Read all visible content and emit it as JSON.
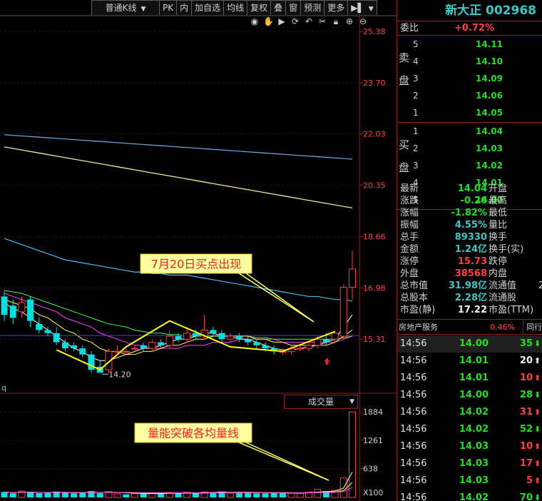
{
  "toolbar": {
    "chart_type": "普通K线",
    "buttons": [
      "PK",
      "内",
      "加自选",
      "均线",
      "复权",
      "叠",
      "窗",
      "预测",
      "更多"
    ]
  },
  "tool_icons": [
    "eye-icon",
    "hand-icon",
    "play-icon",
    "refresh-icon",
    "undo-icon",
    "scissors-icon",
    "lock-icon",
    "zoom-in-icon",
    "zoom-out-icon"
  ],
  "price_axis": [
    "25.38",
    "23.70",
    "22.03",
    "20.35",
    "18.66",
    "16.98",
    "15.31"
  ],
  "volume_axis": [
    "1884",
    "1261",
    "638",
    "X100"
  ],
  "low_label": "14.20",
  "annotations": {
    "buy_point": "7月20日买点出现",
    "volume_break": "量能突破各均量线"
  },
  "volume_selector": "成交量",
  "q_label": "q",
  "stock": {
    "name": "新大正",
    "code": "002968"
  },
  "weibi": {
    "label": "委比",
    "value": "+0.72%"
  },
  "sell_label": [
    "卖",
    "盘"
  ],
  "buy_label": [
    "买",
    "盘"
  ],
  "asks": [
    {
      "level": "5",
      "price": "14.11"
    },
    {
      "level": "4",
      "price": "14.10"
    },
    {
      "level": "3",
      "price": "14.09"
    },
    {
      "level": "2",
      "price": "14.06"
    },
    {
      "level": "1",
      "price": "14.05"
    }
  ],
  "bids": [
    {
      "level": "1",
      "price": "14.04"
    },
    {
      "level": "2",
      "price": "14.03"
    },
    {
      "level": "3",
      "price": "14.02"
    },
    {
      "level": "4",
      "price": "14.01"
    },
    {
      "level": "5",
      "price": "14.00"
    }
  ],
  "stats": [
    {
      "l1": "最新",
      "v1": "14.04",
      "c1": "green",
      "l2": "开盘",
      "v2": ""
    },
    {
      "l1": "涨跌",
      "v1": "-0.26",
      "c1": "green",
      "l2": "最高",
      "v2": ""
    },
    {
      "l1": "涨幅",
      "v1": "-1.82%",
      "c1": "green",
      "l2": "最低",
      "v2": ""
    },
    {
      "l1": "振幅",
      "v1": "4.55%",
      "c1": "cyan",
      "l2": "量比",
      "v2": ""
    },
    {
      "l1": "总手",
      "v1": "89330",
      "c1": "cyan",
      "l2": "换手",
      "v2": ""
    },
    {
      "l1": "金额",
      "v1": "1.24亿",
      "c1": "cyan",
      "l2": "换手(实)",
      "v2": ""
    },
    {
      "l1": "涨停",
      "v1": "15.73",
      "c1": "red",
      "l2": "跌停",
      "v2": ""
    },
    {
      "l1": "外盘",
      "v1": "38568",
      "c1": "red",
      "l2": "内盘",
      "v2": ""
    },
    {
      "l1": "总市值",
      "v1": "31.98亿",
      "c1": "cyan",
      "l2": "流通值",
      "v2": "2"
    },
    {
      "l1": "总股本",
      "v1": "2.28亿",
      "c1": "cyan",
      "l2": "流通股",
      "v2": ""
    },
    {
      "l1": "市盈(静)",
      "v1": "17.22",
      "c1": "white",
      "l2": "市盈(TTM)",
      "v2": ""
    }
  ],
  "sector": {
    "name": "房地产服务",
    "pct": "0.46%",
    "tab": "同行"
  },
  "ticks": [
    {
      "time": "14:56",
      "price": "14.00",
      "vol": "35",
      "dir": "down",
      "vc": "green"
    },
    {
      "time": "14:56",
      "price": "14.01",
      "vol": "20",
      "dir": "up",
      "vc": "white"
    },
    {
      "time": "14:56",
      "price": "14.01",
      "vol": "10",
      "dir": "up",
      "vc": "red"
    },
    {
      "time": "14:56",
      "price": "14.00",
      "vol": "28",
      "dir": "down",
      "vc": "green"
    },
    {
      "time": "14:56",
      "price": "14.02",
      "vol": "31",
      "dir": "up",
      "vc": "red"
    },
    {
      "time": "14:56",
      "price": "14.02",
      "vol": "52",
      "dir": "down",
      "vc": "green"
    },
    {
      "time": "14:56",
      "price": "14.03",
      "vol": "10",
      "dir": "up",
      "vc": "red"
    },
    {
      "time": "14:56",
      "price": "14.03",
      "vol": "17",
      "dir": "up",
      "vc": "red"
    },
    {
      "time": "14:56",
      "price": "14.03",
      "vol": "5",
      "dir": "up",
      "vc": "red"
    },
    {
      "time": "14:56",
      "price": "14.02",
      "vol": "70",
      "dir": "down",
      "vc": "green"
    }
  ],
  "colors": {
    "up": "#ff3c3c",
    "down": "#00e0e0",
    "ma5": "#ffffff",
    "ma10": "#ffff40",
    "ma20": "#ff40ff",
    "ma30": "#40ff40",
    "ma60": "#4fb8e8",
    "ma120": "#f0e6a0",
    "ma250": "#6aa0d0",
    "zigzag": "#ffff00",
    "panel_border": "#8a2020"
  },
  "chart_data": {
    "type": "candlestick",
    "price_ylim": [
      13.6,
      25.9
    ],
    "candles": [
      {
        "o": 16.7,
        "c": 16.1,
        "h": 16.9,
        "l": 15.9
      },
      {
        "o": 16.4,
        "c": 16.0,
        "h": 16.6,
        "l": 15.8
      },
      {
        "o": 16.2,
        "c": 16.5,
        "h": 16.7,
        "l": 16.0
      },
      {
        "o": 16.6,
        "c": 15.9,
        "h": 16.7,
        "l": 15.7
      },
      {
        "o": 15.8,
        "c": 15.6,
        "h": 16.0,
        "l": 15.5
      },
      {
        "o": 15.6,
        "c": 15.5,
        "h": 15.7,
        "l": 15.4
      },
      {
        "o": 15.5,
        "c": 15.2,
        "h": 15.7,
        "l": 15.1
      },
      {
        "o": 15.2,
        "c": 15.0,
        "h": 15.3,
        "l": 14.9
      },
      {
        "o": 15.1,
        "c": 15.0,
        "h": 15.2,
        "l": 14.9
      },
      {
        "o": 15.0,
        "c": 14.8,
        "h": 15.1,
        "l": 14.7
      },
      {
        "o": 14.8,
        "c": 14.3,
        "h": 14.9,
        "l": 14.2
      },
      {
        "o": 14.4,
        "c": 14.2,
        "h": 14.6,
        "l": 14.2
      },
      {
        "o": 14.3,
        "c": 14.9,
        "h": 15.0,
        "l": 14.2
      },
      {
        "o": 14.9,
        "c": 14.9,
        "h": 15.1,
        "l": 14.8
      },
      {
        "o": 14.9,
        "c": 14.9,
        "h": 15.0,
        "l": 14.8
      },
      {
        "o": 15.0,
        "c": 15.0,
        "h": 15.1,
        "l": 14.9
      },
      {
        "o": 15.1,
        "c": 15.0,
        "h": 15.2,
        "l": 14.9
      },
      {
        "o": 15.0,
        "c": 15.2,
        "h": 15.3,
        "l": 14.9
      },
      {
        "o": 15.2,
        "c": 15.1,
        "h": 15.3,
        "l": 15.0
      },
      {
        "o": 15.1,
        "c": 15.4,
        "h": 15.6,
        "l": 15.0
      },
      {
        "o": 15.4,
        "c": 15.3,
        "h": 15.5,
        "l": 15.2
      },
      {
        "o": 15.3,
        "c": 15.5,
        "h": 15.7,
        "l": 15.2
      },
      {
        "o": 15.5,
        "c": 15.4,
        "h": 15.6,
        "l": 15.3
      },
      {
        "o": 15.4,
        "c": 15.6,
        "h": 16.1,
        "l": 15.3
      },
      {
        "o": 15.6,
        "c": 15.5,
        "h": 15.7,
        "l": 15.4
      },
      {
        "o": 15.5,
        "c": 15.3,
        "h": 15.6,
        "l": 15.2
      },
      {
        "o": 15.3,
        "c": 15.4,
        "h": 15.5,
        "l": 15.2
      },
      {
        "o": 15.4,
        "c": 15.3,
        "h": 15.5,
        "l": 15.2
      },
      {
        "o": 15.3,
        "c": 15.2,
        "h": 15.4,
        "l": 15.1
      },
      {
        "o": 15.2,
        "c": 15.1,
        "h": 15.3,
        "l": 15.0
      },
      {
        "o": 15.1,
        "c": 15.0,
        "h": 15.2,
        "l": 14.9
      },
      {
        "o": 15.0,
        "c": 14.9,
        "h": 15.1,
        "l": 14.8
      },
      {
        "o": 14.9,
        "c": 14.9,
        "h": 15.0,
        "l": 14.8
      },
      {
        "o": 14.9,
        "c": 15.0,
        "h": 15.1,
        "l": 14.8
      },
      {
        "o": 15.0,
        "c": 15.0,
        "h": 15.1,
        "l": 14.9
      },
      {
        "o": 15.0,
        "c": 15.1,
        "h": 15.2,
        "l": 14.9
      },
      {
        "o": 15.1,
        "c": 15.3,
        "h": 15.4,
        "l": 15.0
      },
      {
        "o": 15.3,
        "c": 15.2,
        "h": 15.5,
        "l": 15.1
      },
      {
        "o": 15.3,
        "c": 15.5,
        "h": 15.6,
        "l": 15.2
      },
      {
        "o": 15.4,
        "c": 17.0,
        "h": 17.1,
        "l": 15.3
      },
      {
        "o": 17.0,
        "c": 17.6,
        "h": 18.2,
        "l": 16.6
      }
    ],
    "volume_ylim": [
      0,
      1950
    ],
    "volumes": [
      120,
      90,
      140,
      110,
      95,
      100,
      130,
      105,
      90,
      115,
      140,
      95,
      130,
      80,
      70,
      90,
      85,
      100,
      80,
      110,
      95,
      115,
      100,
      120,
      110,
      130,
      95,
      105,
      120,
      90,
      85,
      110,
      95,
      100,
      90,
      120,
      180,
      140,
      160,
      430,
      1884
    ],
    "volume_up": [
      false,
      false,
      true,
      false,
      false,
      false,
      false,
      false,
      false,
      false,
      false,
      false,
      true,
      true,
      false,
      true,
      false,
      true,
      false,
      true,
      false,
      true,
      false,
      true,
      false,
      false,
      true,
      false,
      false,
      false,
      false,
      false,
      false,
      true,
      true,
      true,
      true,
      false,
      true,
      true,
      true
    ],
    "ma": {
      "ma5": [
        16.5,
        16.3,
        16.2,
        16.0,
        15.8,
        15.6,
        15.4,
        15.2,
        15.0,
        14.9,
        14.7,
        14.6,
        14.6,
        14.7,
        14.8,
        14.9,
        15.0,
        15.0,
        15.1,
        15.2,
        15.3,
        15.3,
        15.4,
        15.5,
        15.5,
        15.4,
        15.4,
        15.3,
        15.3,
        15.2,
        15.1,
        15.0,
        14.95,
        14.95,
        15.0,
        15.05,
        15.1,
        15.2,
        15.3,
        15.7,
        16.1
      ],
      "ma10": [
        16.6,
        16.5,
        16.4,
        16.3,
        16.1,
        16.0,
        15.8,
        15.6,
        15.5,
        15.3,
        15.2,
        15.0,
        14.9,
        14.9,
        14.8,
        14.8,
        14.9,
        14.9,
        15.0,
        15.1,
        15.1,
        15.2,
        15.3,
        15.3,
        15.4,
        15.4,
        15.4,
        15.4,
        15.4,
        15.3,
        15.3,
        15.2,
        15.2,
        15.1,
        15.1,
        15.1,
        15.1,
        15.1,
        15.2,
        15.4,
        15.6
      ],
      "ma20": [
        16.8,
        16.7,
        16.6,
        16.5,
        16.4,
        16.3,
        16.2,
        16.0,
        15.9,
        15.8,
        15.7,
        15.5,
        15.4,
        15.3,
        15.2,
        15.1,
        15.1,
        15.0,
        15.0,
        15.0,
        15.0,
        15.1,
        15.1,
        15.1,
        15.2,
        15.2,
        15.2,
        15.3,
        15.3,
        15.3,
        15.3,
        15.3,
        15.2,
        15.2,
        15.2,
        15.2,
        15.2,
        15.2,
        15.2,
        15.3,
        15.4
      ],
      "ma30": [
        16.9,
        16.85,
        16.8,
        16.7,
        16.6,
        16.5,
        16.4,
        16.3,
        16.2,
        16.1,
        16.0,
        15.9,
        15.8,
        15.75,
        15.7,
        15.6,
        15.55,
        15.5,
        15.5,
        15.45,
        15.45,
        15.4,
        15.4,
        15.4,
        15.4,
        15.4,
        15.4,
        15.4,
        15.4,
        15.35,
        15.35,
        15.3,
        15.3,
        15.3,
        15.3,
        15.3,
        15.3,
        15.3,
        15.3,
        15.35,
        15.4
      ],
      "ma60": [
        18.6,
        18.5,
        18.4,
        18.3,
        18.2,
        18.1,
        18.0,
        17.9,
        17.85,
        17.8,
        17.75,
        17.7,
        17.65,
        17.6,
        17.55,
        17.5,
        17.5,
        17.45,
        17.45,
        17.4,
        17.4,
        17.4,
        17.35,
        17.3,
        17.25,
        17.2,
        17.15,
        17.1,
        17.05,
        17.0,
        16.95,
        16.9,
        16.85,
        16.8,
        16.75,
        16.7,
        16.7,
        16.65,
        16.6,
        16.6,
        16.55
      ],
      "ma120": [
        21.6,
        21.55,
        21.5,
        21.45,
        21.4,
        21.35,
        21.3,
        21.25,
        21.2,
        21.15,
        21.1,
        21.05,
        21.0,
        20.95,
        20.9,
        20.85,
        20.8,
        20.75,
        20.7,
        20.65,
        20.6,
        20.55,
        20.5,
        20.45,
        20.4,
        20.35,
        20.3,
        20.25,
        20.2,
        20.15,
        20.1,
        20.05,
        20.0,
        19.95,
        19.9,
        19.85,
        19.8,
        19.75,
        19.7,
        19.65,
        19.6
      ],
      "ma250": [
        22.0,
        21.98,
        21.96,
        21.94,
        21.92,
        21.9,
        21.88,
        21.86,
        21.84,
        21.82,
        21.8,
        21.78,
        21.76,
        21.74,
        21.72,
        21.7,
        21.68,
        21.66,
        21.64,
        21.62,
        21.6,
        21.58,
        21.56,
        21.54,
        21.52,
        21.5,
        21.48,
        21.46,
        21.44,
        21.42,
        21.4,
        21.38,
        21.36,
        21.34,
        21.32,
        21.3,
        21.28,
        21.26,
        21.24,
        21.22,
        21.2
      ]
    },
    "reference_line": 15.42,
    "zigzag": [
      14.95,
      14.3,
      15.05,
      15.9,
      15.05,
      14.9,
      15.55
    ],
    "zigzag_index": [
      6,
      11,
      14,
      19,
      26,
      32,
      38
    ]
  }
}
